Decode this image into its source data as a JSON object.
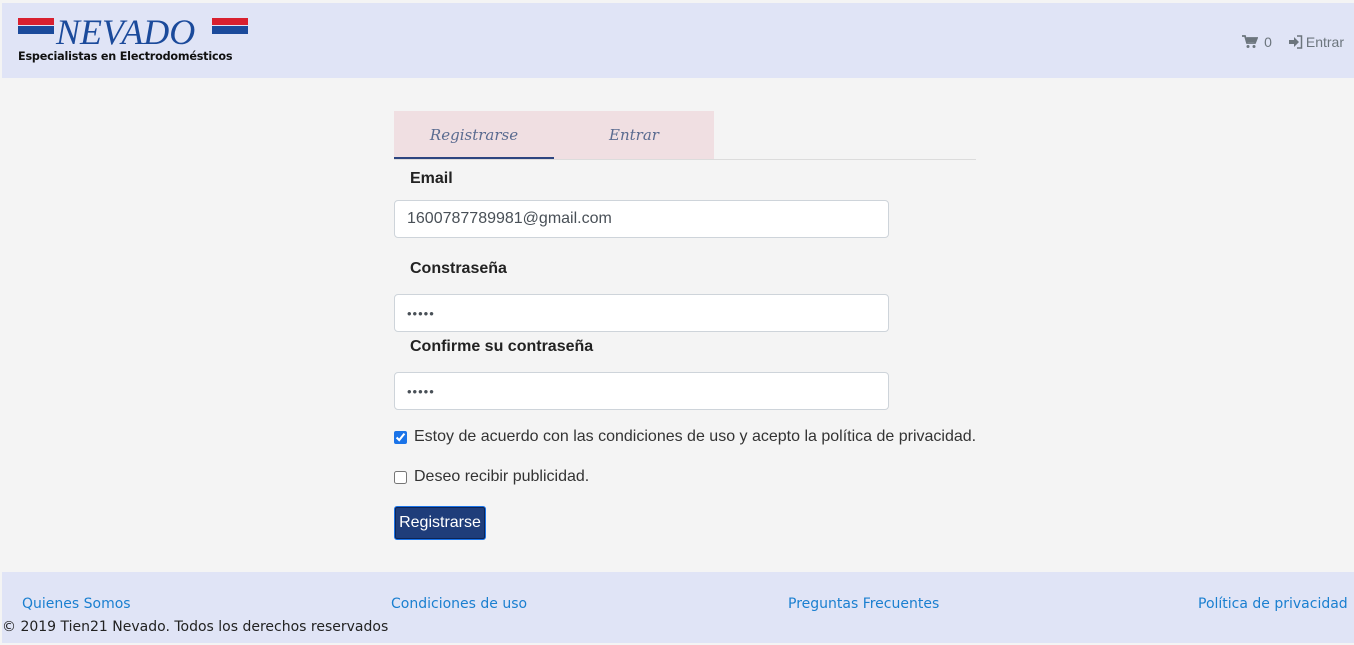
{
  "header": {
    "brand": "NEVADO",
    "tagline": "Especialistas en Electrodomésticos",
    "cart_icon": "shopping-cart-icon",
    "cart_count": "0",
    "login_icon": "sign-in-icon",
    "login_label": "Entrar"
  },
  "tabs": [
    {
      "label": "Registrarse",
      "active": true
    },
    {
      "label": "Entrar",
      "active": false
    }
  ],
  "form": {
    "email_label": "Email",
    "email_value": "1600787789981@gmail.com",
    "password_label": "Constraseña",
    "password_value": "•••••",
    "confirm_label": "Confirme su contraseña",
    "confirm_value": "•••••",
    "terms_label": "Estoy de acuerdo con las condiciones de uso y acepto la política de privacidad.",
    "terms_checked": true,
    "ads_label": "Deseo recibir publicidad.",
    "ads_checked": false,
    "submit_label": "Registrarse"
  },
  "footer": {
    "links": [
      "Quienes Somos",
      "Condiciones de uso",
      "Preguntas Frecuentes",
      "Política de privacidad"
    ],
    "copyright": "© 2019 Tien21 Nevado. Todos los derechos reservados"
  },
  "colors": {
    "header_bg": "#e0e4f6",
    "tab_bg": "#f0dfe2",
    "button_bg": "#1f3d7a",
    "link": "#1a7fd0",
    "brand_blue": "#1b4a9b",
    "brand_red": "#d8202f"
  }
}
